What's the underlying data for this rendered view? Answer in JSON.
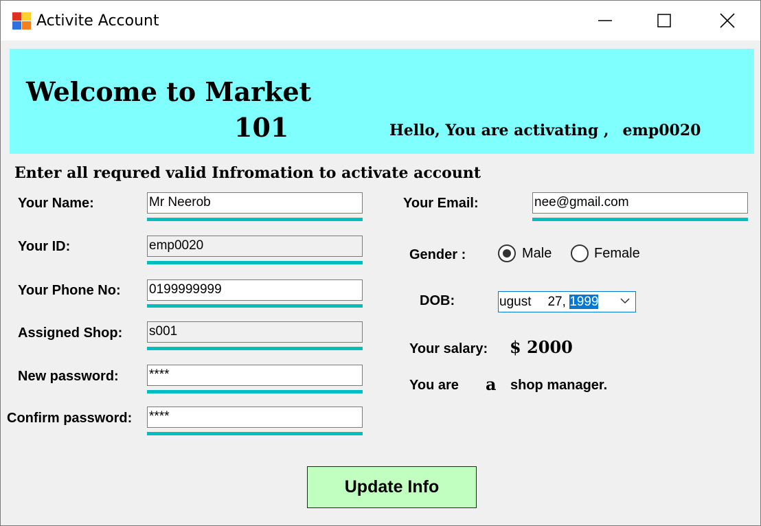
{
  "window": {
    "title": "Activite Account"
  },
  "banner": {
    "welcome": "Welcome to Market",
    "number": "101",
    "hello": "Hello, You are activating ,",
    "employee_id": "emp0020"
  },
  "instructions": "Enter all requred valid Infromation to activate account",
  "form": {
    "name_label": "Your Name:",
    "name_value": "Mr Neerob",
    "id_label": "Your ID:",
    "id_value": "emp0020",
    "phone_label": "Your Phone No:",
    "phone_value": "0199999999",
    "shop_label": "Assigned Shop:",
    "shop_value": "s001",
    "new_password_label": "New password:",
    "new_password_value": "****",
    "confirm_password_label": "Confirm password:",
    "confirm_password_value": "****",
    "email_label": "Your Email:",
    "email_value": "nee@gmail.com",
    "gender_label": "Gender :",
    "gender_options": [
      "Male",
      "Female"
    ],
    "gender_selected": "Male",
    "dob_label": "DOB:",
    "dob_month": "ugust",
    "dob_day": "27,",
    "dob_year": "1999",
    "salary_label": "Your salary:",
    "salary_value": "$ 2000",
    "role_prefix": "You are",
    "role_article": "a",
    "role_suffix": "shop manager."
  },
  "update_button": "Update Info",
  "colors": {
    "banner": "#80ffff",
    "underline": "#00bebe",
    "button": "#c0ffc0",
    "selection": "#0078d7"
  },
  "icons": {
    "app": "app-icon",
    "minimize": "minimize-icon",
    "maximize": "maximize-icon",
    "close": "close-icon",
    "dropdown": "chevron-down-icon"
  }
}
